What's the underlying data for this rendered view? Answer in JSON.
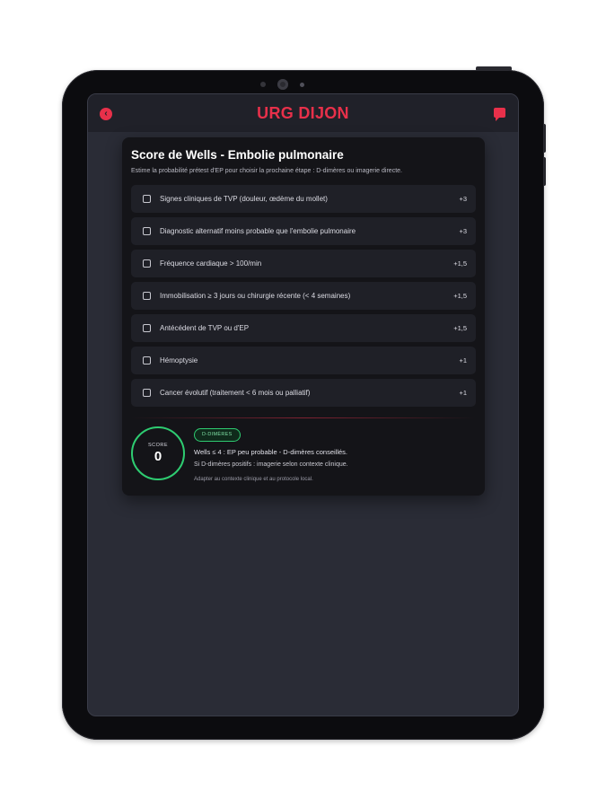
{
  "app": {
    "title": "URG DIJON"
  },
  "card": {
    "heading": "Score de Wells - Embolie pulmonaire",
    "description": "Estime la probabilité prétest d'EP pour choisir la prochaine étape : D-dimères ou imagerie directe.",
    "items": [
      {
        "label": "Signes cliniques de TVP (douleur, œdème du mollet)",
        "points": "+3",
        "checked": false
      },
      {
        "label": "Diagnostic alternatif moins probable que l'embolie pulmonaire",
        "points": "+3",
        "checked": false
      },
      {
        "label": "Fréquence cardiaque > 100/min",
        "points": "+1,5",
        "checked": false
      },
      {
        "label": "Immobilisation ≥ 3 jours ou chirurgie récente (< 4 semaines)",
        "points": "+1,5",
        "checked": false
      },
      {
        "label": "Antécédent de TVP ou d'EP",
        "points": "+1,5",
        "checked": false
      },
      {
        "label": "Hémoptysie",
        "points": "+1",
        "checked": false
      },
      {
        "label": "Cancer évolutif (traitement < 6 mois ou palliatif)",
        "points": "+1",
        "checked": false
      }
    ]
  },
  "result": {
    "score_caption": "SCORE",
    "score_value": "0",
    "badge": "D-DIMÈRES",
    "line1": "Wells ≤ 4 : EP peu probable - D-dimères conseillés.",
    "line2": "Si D-dimères positifs : imagerie selon contexte clinique.",
    "note": "Adapter au contexte clinique et au protocole local."
  },
  "colors": {
    "accent": "#e8304a",
    "success": "#2ecc71",
    "card_bg": "#141418",
    "screen_bg": "#2a2c36"
  },
  "icons": {
    "back": "chevron-left-icon",
    "chat": "chat-icon"
  }
}
